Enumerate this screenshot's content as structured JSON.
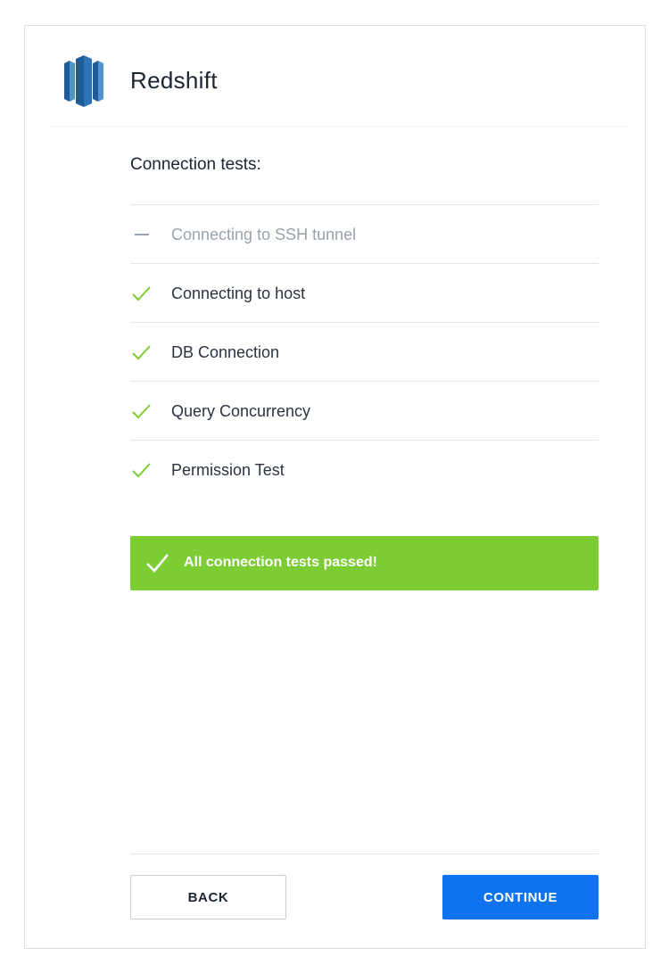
{
  "header": {
    "app_name": "Redshift",
    "logo_icon": "redshift-logo-icon"
  },
  "connection_tests": {
    "title": "Connection tests:",
    "items": [
      {
        "label": "Connecting to SSH tunnel",
        "status": "skipped",
        "icon": "dash-icon"
      },
      {
        "label": "Connecting to host",
        "status": "passed",
        "icon": "check-icon"
      },
      {
        "label": "DB Connection",
        "status": "passed",
        "icon": "check-icon"
      },
      {
        "label": "Query Concurrency",
        "status": "passed",
        "icon": "check-icon"
      },
      {
        "label": "Permission Test",
        "status": "passed",
        "icon": "check-icon"
      }
    ]
  },
  "banner": {
    "message": "All connection tests passed!",
    "icon": "check-icon",
    "color": "#7ccd33"
  },
  "footer": {
    "back_label": "BACK",
    "continue_label": "CONTINUE"
  },
  "colors": {
    "accent": "#0f73ee",
    "success": "#7ccd33",
    "skipped": "#9aa3ad"
  }
}
